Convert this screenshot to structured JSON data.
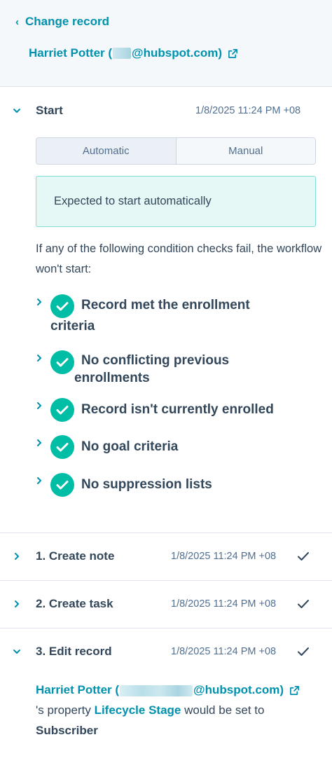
{
  "header": {
    "back_label": "Change record",
    "record_name_prefix": "Harriet Potter (",
    "record_email_suffix": "@hubspot.com)"
  },
  "start": {
    "title": "Start",
    "timestamp": "1/8/2025 11:24 PM +08",
    "toggle": {
      "automatic": "Automatic",
      "manual": "Manual",
      "selected": "Automatic"
    },
    "alert": "Expected to start automatically",
    "condition_intro": "If any of the following condition checks fail, the workflow won't start:",
    "checks": [
      {
        "label_line1": "Record met the enrollment",
        "label_line2": "criteria"
      },
      {
        "label_line1": "No conflicting previous",
        "label_line2": "enrollments"
      },
      {
        "label_line1": "Record isn't currently enrolled"
      },
      {
        "label_line1": "No goal criteria"
      },
      {
        "label_line1": "No suppression lists"
      }
    ]
  },
  "actions": [
    {
      "title": "1. Create note",
      "timestamp": "1/8/2025 11:24 PM +08"
    },
    {
      "title": "2. Create task",
      "timestamp": "1/8/2025 11:24 PM +08"
    },
    {
      "title": "3. Edit record",
      "timestamp": "1/8/2025 11:24 PM +08"
    }
  ],
  "edit_detail": {
    "record_prefix": "Harriet Potter (",
    "record_suffix": "@hubspot.com)",
    "text_before_property": "'s property",
    "property_name": "Lifecycle Stage",
    "text_after_property": "would be set to",
    "value": "Subscriber"
  },
  "colors": {
    "accent": "#0091ae",
    "success": "#00bda5",
    "text": "#33475b",
    "alert_bg": "#e5f8f6",
    "alert_border": "#7fded2"
  }
}
